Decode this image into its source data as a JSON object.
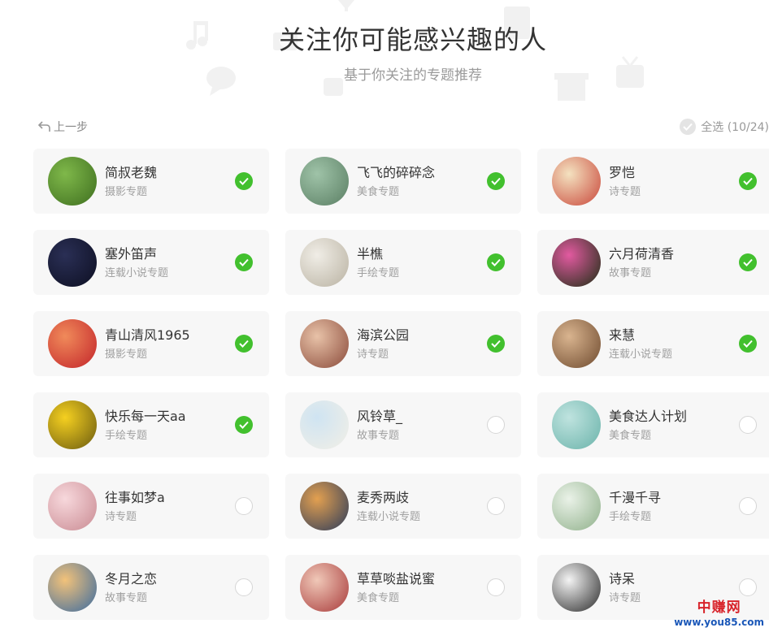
{
  "header": {
    "title": "关注你可能感兴趣的人",
    "subtitle": "基于你关注的专题推荐"
  },
  "nav": {
    "back_label": "上一步",
    "select_all_label": "全选 (10/24)"
  },
  "cards": [
    {
      "name": "简叔老魏",
      "category": "摄影专题",
      "selected": true,
      "avatar_colors": [
        "#7fb84a",
        "#3e6e1f"
      ]
    },
    {
      "name": "飞飞的碎碎念",
      "category": "美食专题",
      "selected": true,
      "avatar_colors": [
        "#9fc3a8",
        "#5a7e63"
      ]
    },
    {
      "name": "罗恺",
      "category": "诗专题",
      "selected": true,
      "avatar_colors": [
        "#f4e2c0",
        "#c9473a"
      ]
    },
    {
      "name": "塞外笛声",
      "category": "连载小说专题",
      "selected": true,
      "avatar_colors": [
        "#2a2f55",
        "#0d0f22"
      ]
    },
    {
      "name": "半樵",
      "category": "手绘专题",
      "selected": true,
      "avatar_colors": [
        "#f0ede6",
        "#b9b2a2"
      ]
    },
    {
      "name": "六月荷清香",
      "category": "故事专题",
      "selected": true,
      "avatar_colors": [
        "#e25aa0",
        "#1b2e12"
      ]
    },
    {
      "name": "青山清风1965",
      "category": "摄影专题",
      "selected": true,
      "avatar_colors": [
        "#f08a5a",
        "#c3242a"
      ]
    },
    {
      "name": "海滨公园",
      "category": "诗专题",
      "selected": true,
      "avatar_colors": [
        "#e8c2a8",
        "#8a4a3a"
      ]
    },
    {
      "name": "来慧",
      "category": "连载小说专题",
      "selected": true,
      "avatar_colors": [
        "#d9b48f",
        "#6e4a2e"
      ]
    },
    {
      "name": "快乐每一天aa",
      "category": "手绘专题",
      "selected": true,
      "avatar_colors": [
        "#f5d020",
        "#6a5a10"
      ]
    },
    {
      "name": "风铃草_",
      "category": "故事专题",
      "selected": false,
      "avatar_colors": [
        "#cfe4f2",
        "#f2efe6"
      ]
    },
    {
      "name": "美食达人计划",
      "category": "美食专题",
      "selected": false,
      "avatar_colors": [
        "#bfe3df",
        "#6ab3aa"
      ]
    },
    {
      "name": "往事如梦a",
      "category": "诗专题",
      "selected": false,
      "avatar_colors": [
        "#f7d8dc",
        "#c98a92"
      ]
    },
    {
      "name": "麦秀两歧",
      "category": "连载小说专题",
      "selected": false,
      "avatar_colors": [
        "#e3a050",
        "#2a3a5a"
      ]
    },
    {
      "name": "千漫千寻",
      "category": "手绘专题",
      "selected": false,
      "avatar_colors": [
        "#eaf2e8",
        "#8fb08a"
      ]
    },
    {
      "name": "冬月之恋",
      "category": "故事专题",
      "selected": false,
      "avatar_colors": [
        "#f2c27a",
        "#3a6aa0"
      ]
    },
    {
      "name": "草草啖盐说蜜",
      "category": "美食专题",
      "selected": false,
      "avatar_colors": [
        "#f0c8b8",
        "#a83a3a"
      ]
    },
    {
      "name": "诗呆",
      "category": "诗专题",
      "selected": false,
      "avatar_colors": [
        "#f4f4f4",
        "#2a2a2a"
      ]
    }
  ],
  "watermark": {
    "line1": "中赚网",
    "line2": "www.you85.com"
  }
}
